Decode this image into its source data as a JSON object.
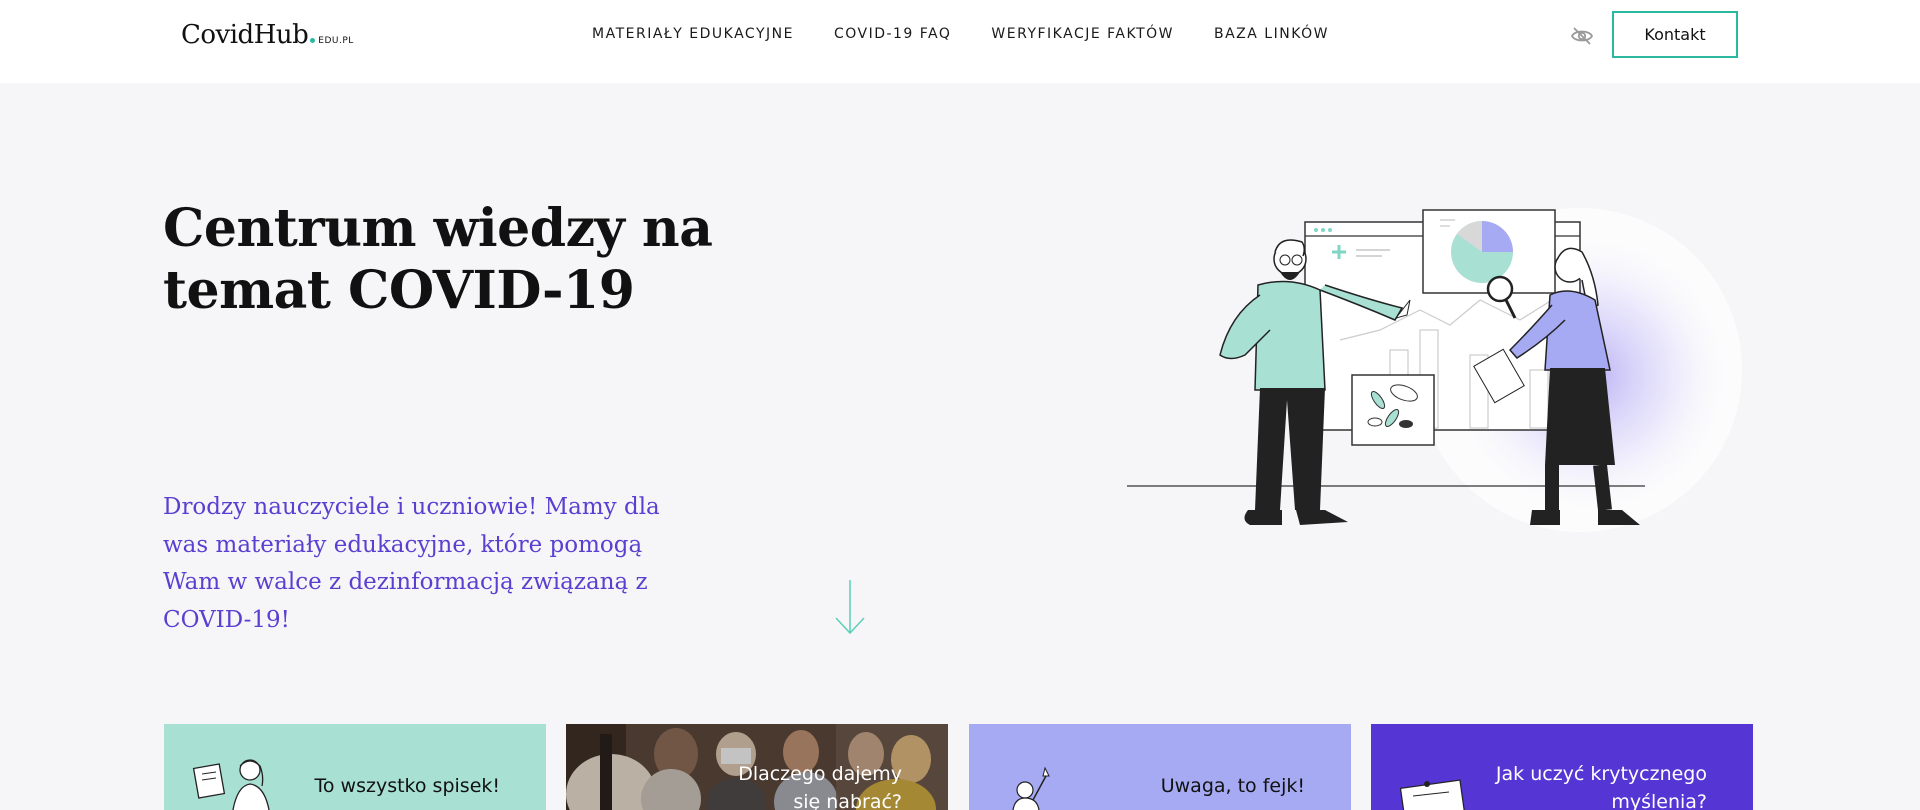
{
  "header": {
    "logo": {
      "name": "CovidHub",
      "suffix": "EDU.PL"
    },
    "nav": [
      {
        "label": "MATERIAŁY EDUKACYJNE"
      },
      {
        "label": "COVID-19 FAQ"
      },
      {
        "label": "WERYFIKACJE FAKTÓW"
      },
      {
        "label": "BAZA LINKÓW"
      }
    ],
    "accessibility_icon": "eye-off-icon",
    "contact_label": "Kontakt"
  },
  "hero": {
    "title": "Centrum wiedzy na temat COVID-19",
    "subtitle": "Drodzy nauczyciele i uczniowie! Mamy dla was materiały edukacyjne, które pomogą Wam w walce z dezinformacją związaną z COVID-19!",
    "scroll_icon": "arrow-down-icon"
  },
  "cards": [
    {
      "label": "To wszystko spisek!",
      "color": "#a8e0d4",
      "text_color": "#111111"
    },
    {
      "label": "Dlaczego dajemy się nabrać?",
      "color": "#6b5547",
      "text_color": "#ffffff"
    },
    {
      "label": "Uwaga, to fejk!",
      "color": "#a6aaf2",
      "text_color": "#111111"
    },
    {
      "label": "Jak uczyć krytycznego myślenia?",
      "color": "#5535d4",
      "text_color": "#ffffff"
    }
  ],
  "colors": {
    "accent": "#2bb8a0",
    "purple": "#5b3fd0",
    "mint": "#a8e0d4",
    "lavender": "#a6aaf2",
    "background": "#f6f6f9"
  }
}
